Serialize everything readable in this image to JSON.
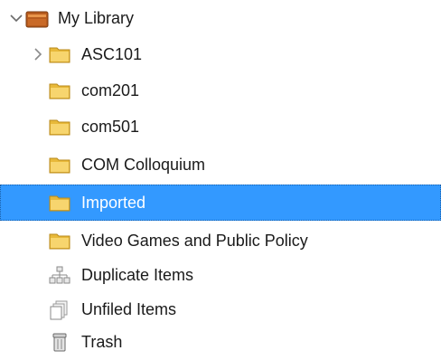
{
  "library": {
    "label": "My Library",
    "icon": "library-icon",
    "expanded": true
  },
  "collections": [
    {
      "label": "ASC101",
      "icon": "folder-icon",
      "has_children": true
    },
    {
      "label": "com201",
      "icon": "folder-icon"
    },
    {
      "label": "com501",
      "icon": "folder-icon"
    },
    {
      "label": "COM Colloquium",
      "icon": "folder-icon"
    },
    {
      "label": "Imported",
      "icon": "folder-icon",
      "selected": true
    },
    {
      "label": "Video Games and Public Policy",
      "icon": "folder-icon"
    }
  ],
  "special": [
    {
      "label": "Duplicate Items",
      "icon": "duplicate-items-icon"
    },
    {
      "label": "Unfiled Items",
      "icon": "unfiled-items-icon"
    },
    {
      "label": "Trash",
      "icon": "trash-icon"
    }
  ],
  "colors": {
    "selection": "#3399ff",
    "folder": "#f2c94c",
    "library": "#b85c1e"
  }
}
